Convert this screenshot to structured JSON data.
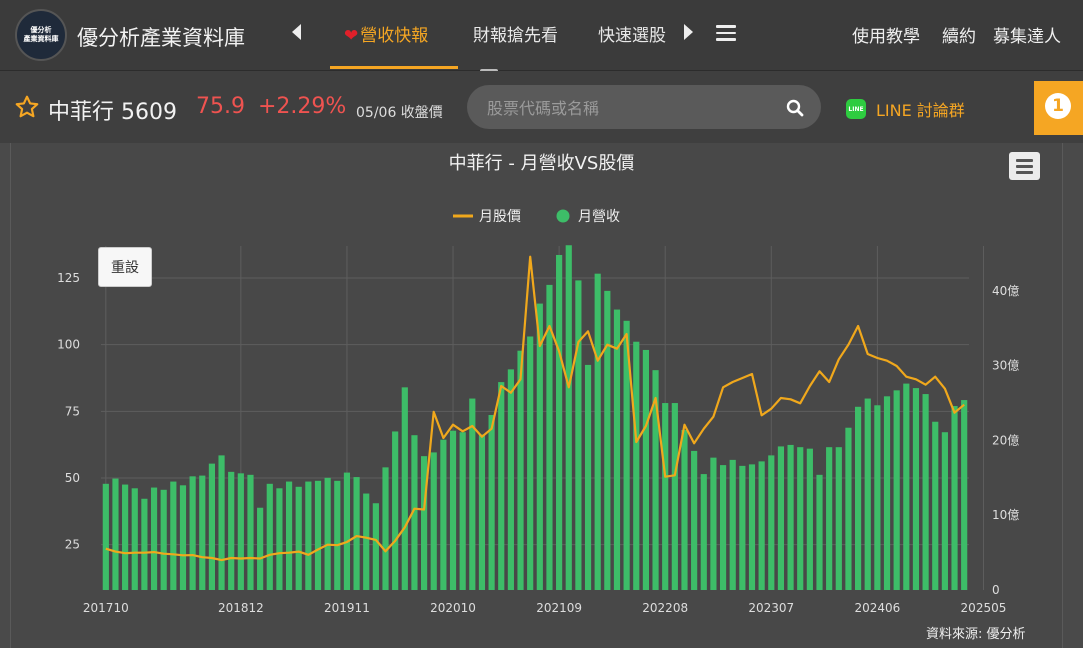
{
  "header": {
    "logo_lines": [
      "優分析",
      "產業資料庫"
    ],
    "brand": "優分析產業資料庫",
    "tabs": [
      {
        "label": "營收快報",
        "active": true,
        "icon": "heart-icon"
      },
      {
        "label": "財報搶先看",
        "active": false
      },
      {
        "label": "快速選股",
        "active": false
      }
    ],
    "links": [
      "使用教學",
      "續約",
      "募集達人"
    ]
  },
  "stock": {
    "name": "中菲行 5609",
    "price": "75.9",
    "change": "+2.29%",
    "date_label": "05/06 收盤價"
  },
  "search": {
    "placeholder": "股票代碼或名稱",
    "value": ""
  },
  "line_link": {
    "icon_text": "LINE",
    "label": "LINE 討論群"
  },
  "notification": {
    "count": "1"
  },
  "colors": {
    "accent": "#f5a623",
    "price_up": "#ef5350",
    "bar": "#3dbd68",
    "line": "#f0a81c",
    "line_green": "#2ecc40"
  },
  "chart": {
    "reset_label": "重設",
    "source": "資料來源: 優分析"
  },
  "chart_data": {
    "type": "bar+line",
    "title": "中菲行 - 月營收VS股價",
    "legend": [
      "月股價",
      "月營收"
    ],
    "legend_position": "top-center",
    "grid": true,
    "x_ticks": [
      "201710",
      "201812",
      "201911",
      "202010",
      "202109",
      "202208",
      "202307",
      "202406",
      "202505"
    ],
    "y_left_ticks": [
      "25",
      "50",
      "75",
      "100",
      "125"
    ],
    "y_right_ticks": [
      "0",
      "10億",
      "20億",
      "30億",
      "40億"
    ],
    "y_left_range": [
      8,
      137
    ],
    "y_right_range": [
      0,
      46
    ],
    "x_start": "2017-10",
    "x_end": "2025-05",
    "series": [
      {
        "name": "月營收",
        "type": "bar",
        "axis": "right",
        "unit": "億",
        "values": [
          14.2,
          14.9,
          14.1,
          13.6,
          12.2,
          13.7,
          13.4,
          14.5,
          14.0,
          15.2,
          15.3,
          16.9,
          18.0,
          15.8,
          15.6,
          15.4,
          11.0,
          14.2,
          13.6,
          14.5,
          13.8,
          14.5,
          14.6,
          15.0,
          14.6,
          15.7,
          15.1,
          12.9,
          11.6,
          16.4,
          21.2,
          27.1,
          20.7,
          17.9,
          18.4,
          20.1,
          21.3,
          21.1,
          25.6,
          20.8,
          23.4,
          27.8,
          29.5,
          32.0,
          33.9,
          38.3,
          40.8,
          44.8,
          46.1,
          41.4,
          30.1,
          42.3,
          40.0,
          37.5,
          36.0,
          33.2,
          32.1,
          29.4,
          25.0,
          25.0,
          21.4,
          18.6,
          15.5,
          17.7,
          16.7,
          17.4,
          16.6,
          16.8,
          17.2,
          18.0,
          19.2,
          19.4,
          19.1,
          18.9,
          15.4,
          19.1,
          19.1,
          21.7,
          24.5,
          25.6,
          24.7,
          25.9,
          26.7,
          27.6,
          27.0,
          26.2,
          22.5,
          21.1,
          24.6,
          25.4
        ]
      },
      {
        "name": "月股價",
        "type": "line",
        "axis": "left",
        "values": [
          23.5,
          22.4,
          21.8,
          22.0,
          22.0,
          22.2,
          21.6,
          21.4,
          21.0,
          21.1,
          20.3,
          20.0,
          19.2,
          20.0,
          19.8,
          20.0,
          19.8,
          21.2,
          21.8,
          22.0,
          22.4,
          21.2,
          23.2,
          25.0,
          24.8,
          26.0,
          28.2,
          27.6,
          26.8,
          22.5,
          26.5,
          31.5,
          38.5,
          38.2,
          74.8,
          65.0,
          70.0,
          67.5,
          69.5,
          65.5,
          68.5,
          84.5,
          82.0,
          87.0,
          133.0,
          99.5,
          107.0,
          97.5,
          84.0,
          101.0,
          105.0,
          94.0,
          100.0,
          98.5,
          104.0,
          63.5,
          69.5,
          80.0,
          50.5,
          51.0,
          70.0,
          63.0,
          68.5,
          73.0,
          84.0,
          86.0,
          87.5,
          89.0,
          73.5,
          76.0,
          80.0,
          79.5,
          78.0,
          84.5,
          90.0,
          86.0,
          94.5,
          100.0,
          107.0,
          96.5,
          95.0,
          94.0,
          92.0,
          88.0,
          87.0,
          85.0,
          88.0,
          83.5,
          74.5,
          77.5
        ]
      }
    ]
  }
}
